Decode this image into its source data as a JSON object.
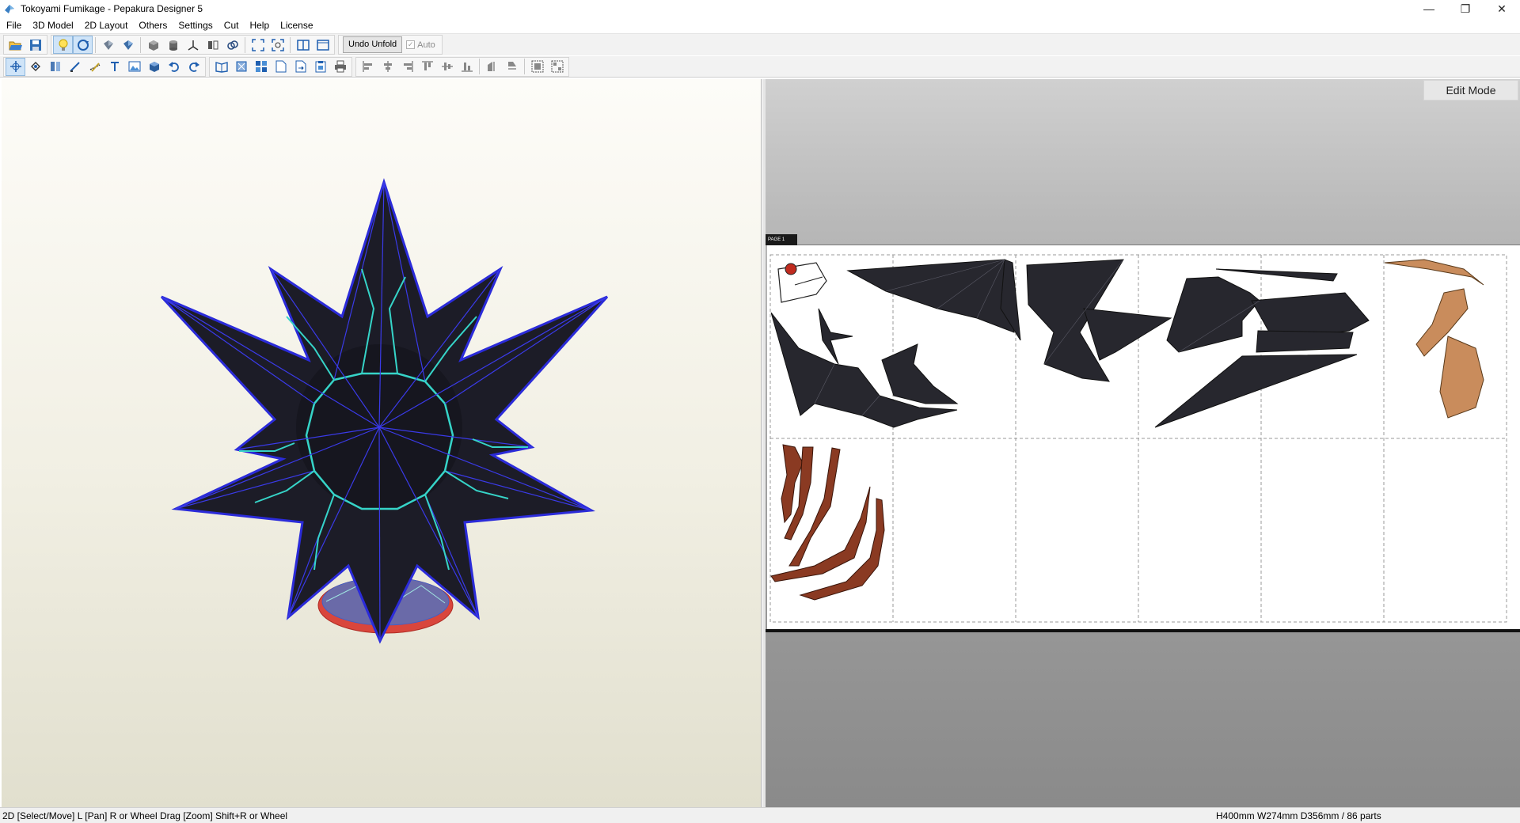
{
  "window": {
    "title": "Tokoyami Fumikage - Pepakura Designer 5",
    "app_icon": "pepakura-icon",
    "controls": {
      "minimize": "—",
      "restore": "❐",
      "close": "✕"
    }
  },
  "menu": {
    "items": [
      "File",
      "3D Model",
      "2D Layout",
      "Others",
      "Settings",
      "Cut",
      "Help",
      "License"
    ]
  },
  "toolbar1": {
    "group1": [
      "open-icon",
      "save-icon"
    ],
    "group2": [
      "light-bulb-icon",
      "rotate-view-icon",
      "model-shade-icon",
      "model-texture-icon",
      "box-icon",
      "cylinder-icon",
      "axis-icon",
      "flip-icon",
      "link-icon",
      "fit-view-icon",
      "zoom-fit-icon",
      "split-view-icon",
      "single-view-icon"
    ],
    "undo_unfold_label": "Undo Unfold",
    "auto_label": "Auto",
    "auto_checked": true
  },
  "toolbar2": {
    "group1": [
      "select-move-icon",
      "rotate-part-icon",
      "join-icon",
      "edit-line-icon",
      "fold-line-icon",
      "text-icon",
      "image-icon",
      "3d-part-icon",
      "undo-icon",
      "redo-icon"
    ],
    "group2": [
      "book-icon",
      "fit-page-icon",
      "arrange-icon",
      "page-setup-icon",
      "export-icon",
      "clipboard-icon",
      "print-icon"
    ],
    "group3": [
      "align-left-icon",
      "align-center-icon",
      "align-right-icon",
      "align-top-icon",
      "align-middle-icon",
      "align-bottom-icon",
      "distribute-h-icon",
      "distribute-v-icon",
      "group-icon",
      "ungroup-icon"
    ]
  },
  "view2d": {
    "edit_mode_label": "Edit Mode",
    "paper_tag": "PAGE 1",
    "grid_columns": 6,
    "grid_rows": 2
  },
  "colors": {
    "model_fill": "#1c1c27",
    "model_edge_blue": "#2b2bd9",
    "model_edge_cyan": "#36d4c8",
    "part_black": "#27272e",
    "part_brown": "#8a3a22",
    "part_tan": "#c98c5c"
  },
  "status": {
    "left": "2D [Select/Move] L [Pan] R or Wheel Drag [Zoom] Shift+R or Wheel",
    "right": "H400mm W274mm D356mm / 86 parts"
  }
}
